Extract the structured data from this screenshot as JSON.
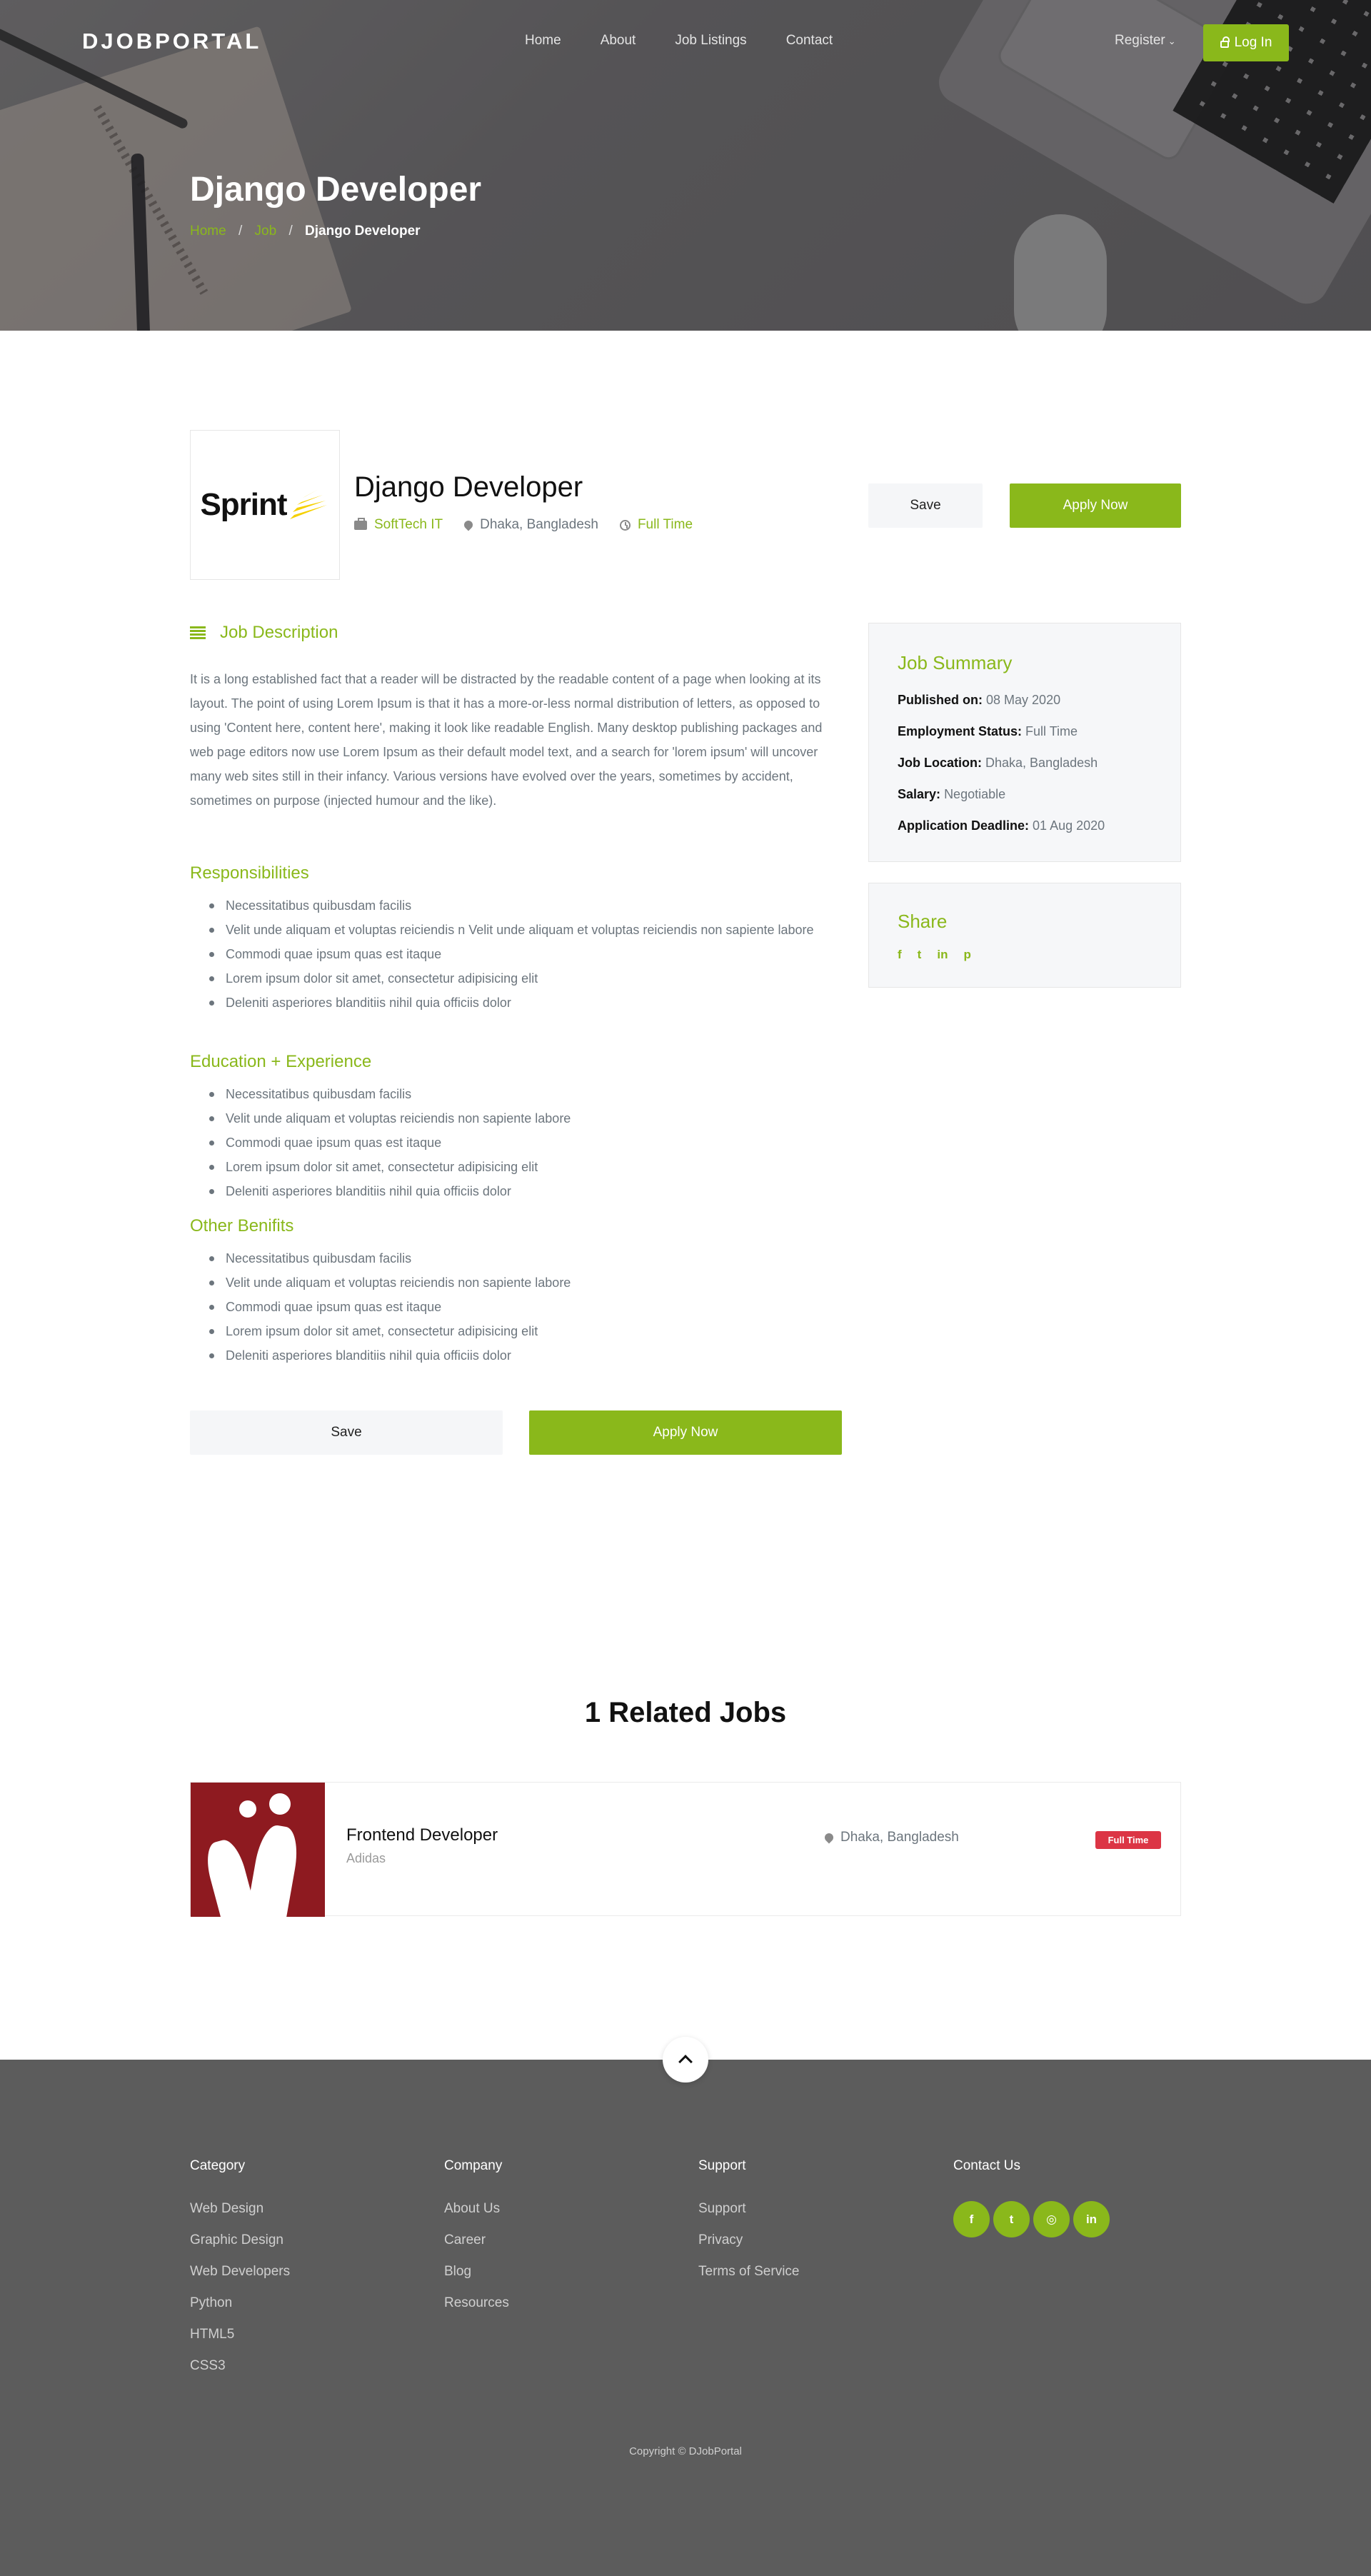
{
  "nav": {
    "logo": "DJOBPORTAL",
    "links": [
      "Home",
      "About",
      "Job Listings",
      "Contact"
    ],
    "register": "Register",
    "login": "Log In"
  },
  "hero": {
    "title": "Django Developer",
    "breadcrumb": [
      "Home",
      "Job",
      "Django Developer"
    ]
  },
  "job": {
    "logo_text": "Sprint",
    "title": "Django Developer",
    "company": "SoftTech IT",
    "location": "Dhaka, Bangladesh",
    "type": "Full Time",
    "save_label": "Save",
    "apply_label": "Apply Now"
  },
  "description": {
    "heading": "Job Description",
    "text": "It is a long established fact that a reader will be distracted by the readable content of a page when looking at its layout. The point of using Lorem Ipsum is that it has a more-or-less normal distribution of letters, as opposed to using 'Content here, content here', making it look like readable English. Many desktop publishing packages and web page editors now use Lorem Ipsum as their default model text, and a search for 'lorem ipsum' will uncover many web sites still in their infancy. Various versions have evolved over the years, sometimes by accident, sometimes on purpose (injected humour and the like)."
  },
  "responsibilities": {
    "title": "Responsibilities",
    "items": [
      "Necessitatibus quibusdam facilis",
      "Velit unde aliquam et voluptas reiciendis n Velit unde aliquam et voluptas reiciendis non sapiente labore",
      "Commodi quae ipsum quas est itaque",
      "Lorem ipsum dolor sit amet, consectetur adipisicing elit",
      "Deleniti asperiores blanditiis nihil quia officiis dolor"
    ]
  },
  "education": {
    "title": "Education + Experience",
    "items": [
      "Necessitatibus quibusdam facilis",
      "Velit unde aliquam et voluptas reiciendis non sapiente labore",
      "Commodi quae ipsum quas est itaque",
      "Lorem ipsum dolor sit amet, consectetur adipisicing elit",
      "Deleniti asperiores blanditiis nihil quia officiis dolor"
    ]
  },
  "benefits": {
    "title": "Other Benifits",
    "items": [
      "Necessitatibus quibusdam facilis",
      "Velit unde aliquam et voluptas reiciendis non sapiente labore",
      "Commodi quae ipsum quas est itaque",
      "Lorem ipsum dolor sit amet, consectetur adipisicing elit",
      "Deleniti asperiores blanditiis nihil quia officiis dolor"
    ]
  },
  "summary": {
    "title": "Job Summary",
    "rows": [
      {
        "label": "Published on:",
        "value": "08 May 2020"
      },
      {
        "label": "Employment Status:",
        "value": "Full Time"
      },
      {
        "label": "Job Location:",
        "value": "Dhaka, Bangladesh"
      },
      {
        "label": "Salary:",
        "value": "Negotiable"
      },
      {
        "label": "Application Deadline:",
        "value": "01 Aug 2020"
      }
    ]
  },
  "share": {
    "title": "Share",
    "icons": [
      "facebook-icon",
      "twitter-icon",
      "linkedin-icon",
      "pinterest-icon"
    ]
  },
  "related": {
    "title": "1 Related Jobs",
    "jobs": [
      {
        "title": "Frontend Developer",
        "company": "Adidas",
        "location": "Dhaka, Bangladesh",
        "badge": "Full Time"
      }
    ]
  },
  "footer": {
    "category": {
      "title": "Category",
      "links": [
        "Web Design",
        "Graphic Design",
        "Web Developers",
        "Python",
        "HTML5",
        "CSS3"
      ]
    },
    "company": {
      "title": "Company",
      "links": [
        "About Us",
        "Career",
        "Blog",
        "Resources"
      ]
    },
    "support": {
      "title": "Support",
      "links": [
        "Support",
        "Privacy",
        "Terms of Service"
      ]
    },
    "contact": {
      "title": "Contact Us",
      "icons": [
        "facebook-icon",
        "twitter-icon",
        "instagram-icon",
        "linkedin-icon"
      ]
    },
    "copyright": "Copyright © DJobPortal"
  },
  "colors": {
    "accent": "#8ab81b",
    "badge_red": "#dc3545",
    "footer_bg": "#5c5c5c"
  }
}
